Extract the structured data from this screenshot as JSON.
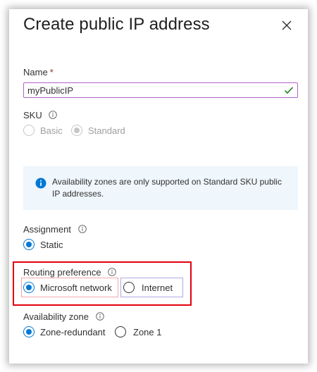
{
  "panel": {
    "title": "Create public IP address",
    "close_icon": "close-icon"
  },
  "name": {
    "label": "Name",
    "required_mark": "*",
    "value": "myPublicIP",
    "valid_icon": "checkmark-icon"
  },
  "sku": {
    "label": "SKU",
    "options": [
      {
        "label": "Basic",
        "selected": false,
        "disabled": true
      },
      {
        "label": "Standard",
        "selected": true,
        "disabled": true
      }
    ]
  },
  "info_banner": {
    "icon": "info-filled-icon",
    "text": "Availability zones are only supported on Standard SKU public IP addresses."
  },
  "assignment": {
    "label": "Assignment",
    "options": [
      {
        "label": "Static",
        "selected": true
      }
    ]
  },
  "routing_preference": {
    "label": "Routing preference",
    "options": [
      {
        "label": "Microsoft network",
        "selected": true
      },
      {
        "label": "Internet",
        "selected": false
      }
    ]
  },
  "availability_zone": {
    "label": "Availability zone",
    "options": [
      {
        "label": "Zone-redundant",
        "selected": true
      },
      {
        "label": "Zone 1",
        "selected": false
      }
    ]
  },
  "colors": {
    "accent": "#0078d4",
    "highlight_red": "#e3000f",
    "input_border": "#b064c8",
    "valid_green": "#107c10",
    "info_bg": "#eff6fc"
  }
}
